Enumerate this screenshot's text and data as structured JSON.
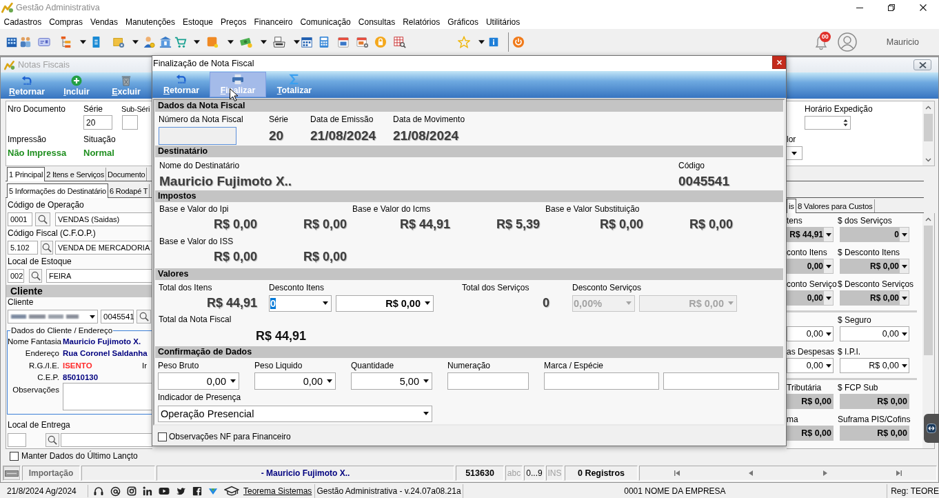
{
  "app": {
    "title": "Gestão Administrativa",
    "menu": [
      "Cadastros",
      "Compras",
      "Vendas",
      "Manutenções",
      "Estoque",
      "Preços",
      "Financeiro",
      "Comunicação",
      "Consultas",
      "Relatórios",
      "Gráficos",
      "Utilitários"
    ],
    "notification_count": "00",
    "user": "Mauricio"
  },
  "notas_fiscais": {
    "title": "Notas Fiscais",
    "toolbar": [
      "Retornar",
      "Incluir",
      "Excluir"
    ],
    "header": {
      "nro_documento_label": "Nro Documento",
      "serie_label": "Série",
      "serie": "20",
      "sub_serie_label": "Sub-Séri",
      "impressao_label": "Impressão",
      "impressao": "Não Impressa",
      "situacao_label": "Situação",
      "situacao": "Normal",
      "horario_expedicao_label": "Horário Expedição",
      "column_fragment_label": "lor"
    },
    "tabs": [
      {
        "label": "1 Principal",
        "selected": true
      },
      {
        "label": "2 Itens e Serviços",
        "selected": false
      },
      {
        "label": "Documento",
        "selected": false
      }
    ],
    "subtabs": [
      {
        "label": "5 Informações do Destinatário",
        "selected": true
      },
      {
        "label": "6 Rodapé T",
        "selected": false
      }
    ],
    "form": {
      "fields": [
        {
          "label": "Código de Operação",
          "code": "0001",
          "name": "VENDAS (Saidas)"
        },
        {
          "label": "Código Fiscal (C.F.O.P.)",
          "code": "5.102",
          "name": "VENDA DE MERCADORIA"
        },
        {
          "label": "Local de Estoque",
          "code": "002",
          "name": "FEIRA"
        }
      ],
      "section_title": "Cliente",
      "cliente_label": "Cliente",
      "cliente_code": "0045541",
      "dados_cliente": {
        "title": "Dados do Cliente / Endereço",
        "rows": [
          {
            "label": "Nome Fantasia",
            "value": "Mauricio Fujimoto X.",
            "color": "#00007f"
          },
          {
            "label": "Endereço",
            "value": "Rua Coronel Saldanha",
            "color": "#00007f"
          },
          {
            "label": "R.G./I.E.",
            "value": "ISENTO",
            "color": "#ff2b2b",
            "side_label": "Ir"
          },
          {
            "label": "C.E.P.",
            "value": "85010130",
            "color": "#00007f"
          }
        ],
        "observacoes_label": "Observações"
      },
      "local_entrega_label": "Local de Entrega"
    },
    "custos_tabs": [
      {
        "label": "is",
        "selected": true
      },
      {
        "label": "8 Valores para Custos",
        "selected": false
      }
    ],
    "custos": {
      "sections": [
        {
          "rows": [
            [
              {
                "label": "tens",
                "value": "R$ 44,91",
                "kind": "locked-combo"
              },
              {
                "label": "$ dos Serviços",
                "value": "0",
                "kind": "locked-combo"
              }
            ],
            [
              {
                "label": "conto Itens",
                "value": "0,00",
                "kind": "locked-combo"
              },
              {
                "label": "$ Desconto Itens",
                "value": "R$ 0,00",
                "kind": "locked-combo"
              }
            ],
            [
              {
                "label": "conto Serviço",
                "value": "0,00",
                "kind": "locked-combo"
              },
              {
                "label": "$ Desconto Serviços",
                "value": "R$ 0,00",
                "kind": "locked-combo"
              }
            ]
          ]
        },
        {
          "rows": [
            [
              {
                "value": "0,00",
                "kind": "combo"
              },
              {
                "label": "$ Seguro",
                "value": "0,00",
                "kind": "combo"
              }
            ],
            [
              {
                "label": "as Despesas",
                "value": "0,00",
                "kind": "combo"
              },
              {
                "label": "$ I.P.I.",
                "value": "R$ 0,00",
                "kind": "combo"
              }
            ]
          ]
        },
        {
          "rows": [
            [
              {
                "label": "Tributária",
                "value": "R$ 0,00",
                "kind": "locked"
              },
              {
                "label": "$ FCP Sub",
                "value": "R$ 0,00",
                "kind": "locked"
              }
            ],
            [
              {
                "label": "ma",
                "value": "R$ 0,00",
                "kind": "locked"
              },
              {
                "label": "Suframa PIS/Cofins",
                "value": "R$ 0,00",
                "kind": "locked"
              }
            ]
          ]
        }
      ]
    },
    "manter_dados": {
      "label": "Manter Dados do Último Lançto",
      "checked": false
    },
    "status_bar": {
      "module": "Importação",
      "cliente": "- Mauricio Fujimoto X..",
      "numero": "513630",
      "indicators": [
        {
          "label": "abc",
          "on": false
        },
        {
          "label": "0...9",
          "on": true
        },
        {
          "label": "INS",
          "on": false
        }
      ],
      "registros": "0 Registros"
    }
  },
  "dialog": {
    "title": "Finalização de Nota Fiscal",
    "toolbar": [
      {
        "label": "Retornar",
        "selected": false
      },
      {
        "label": "Finalizar",
        "selected": true
      },
      {
        "label": "Totalizar",
        "selected": false
      }
    ],
    "dados_nota": {
      "title": "Dados da Nota Fiscal",
      "numero_label": "Número da Nota Fiscal",
      "serie_label": "Série",
      "serie": "20",
      "emissao_label": "Data de Emissão",
      "emissao": "21/08/2024",
      "movimento_label": "Data de Movimento",
      "movimento": "21/08/2024"
    },
    "destinatario": {
      "title": "Destinatário",
      "nome_label": "Nome do Destinatário",
      "nome": "Mauricio Fujimoto X..",
      "codigo_label": "Código",
      "codigo": "0045541"
    },
    "impostos": {
      "title": "Impostos",
      "groups": [
        {
          "label": "Base e Valor do Ipi",
          "values": [
            "R$ 0,00",
            "R$ 0,00"
          ]
        },
        {
          "label": "Base e Valor do Icms",
          "values": [
            "R$ 44,91",
            "R$ 5,39"
          ]
        },
        {
          "label": "Base e Valor Substituição",
          "values": [
            "R$ 0,00",
            "R$ 0,00"
          ]
        },
        {
          "label": "Base e Valor do ISS",
          "values": [
            "R$ 0,00",
            "R$ 0,00"
          ]
        }
      ]
    },
    "valores": {
      "title": "Valores",
      "total_itens_label": "Total dos Itens",
      "total_itens": "R$ 44,91",
      "desconto_itens_label": "Desconto Itens",
      "desconto_itens": {
        "percent": "0",
        "value": "R$ 0,00",
        "focused": true,
        "disabled": false
      },
      "total_servicos_label": "Total dos Serviços",
      "total_servicos": "0",
      "desconto_servicos_label": "Desconto Serviços",
      "desconto_servicos": {
        "percent": "0,00%",
        "value": "R$ 0,00",
        "focused": false,
        "disabled": true
      },
      "total_nota_label": "Total da Nota Fiscal",
      "total_nota": "R$ 44,91"
    },
    "confirmacao": {
      "title": "Confirmação de Dados",
      "fields": [
        {
          "label": "Peso Bruto",
          "value": "0,00",
          "kind": "combo"
        },
        {
          "label": "Peso Liquido",
          "value": "0,00",
          "kind": "combo"
        },
        {
          "label": "Quantidade",
          "value": "5,00",
          "kind": "combo"
        },
        {
          "label": "Numeração",
          "kind": "input"
        },
        {
          "label": "Marca / Espécie",
          "kind": "input"
        },
        {
          "kind": "input"
        }
      ],
      "presenca_label": "Indicador de Presença",
      "presenca": "Operação Presencial"
    },
    "observacoes_nf": {
      "label": "Observações NF para Financeiro",
      "checked": false
    }
  },
  "footer": {
    "date": "21/8/2024 Ag/2024",
    "link": "Teorema Sistemas",
    "version": "Gestão Administrativa - v.24.07a08.21a",
    "company": "0001 NOME DA EMPRESA",
    "reg": "Reg: TEORE"
  }
}
